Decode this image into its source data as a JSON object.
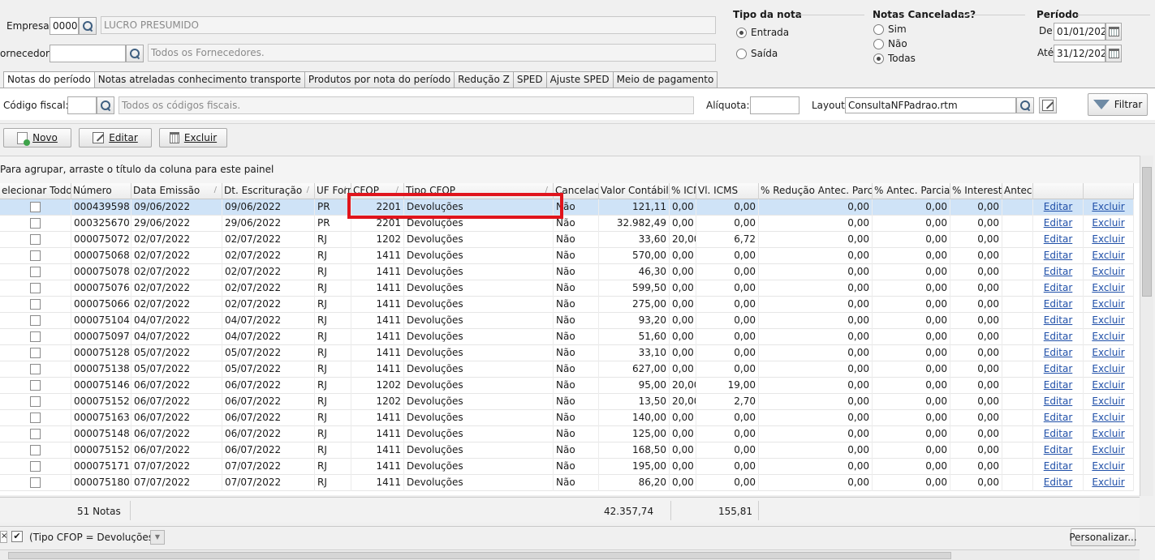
{
  "filters": {
    "empresa_label": "Empresa:",
    "empresa_code": "00001",
    "empresa_name": "LUCRO PRESUMIDO",
    "fornecedor_label": "ornecedor:",
    "fornecedor_code": "",
    "fornecedor_name": "Todos os Fornecedores."
  },
  "tipo_nota": {
    "title": "Tipo da nota",
    "options": [
      {
        "label": "Entrada",
        "selected": true
      },
      {
        "label": "Saída",
        "selected": false
      }
    ]
  },
  "notas_canceladas": {
    "title": "Notas Canceladas?",
    "options": [
      {
        "label": "Sim",
        "selected": false
      },
      {
        "label": "Não",
        "selected": false
      },
      {
        "label": "Todas",
        "selected": true
      }
    ]
  },
  "periodo": {
    "title": "Período",
    "de_label": "De",
    "de_value": "01/01/2022",
    "ate_label": "Até",
    "ate_value": "31/12/2022"
  },
  "tabs": [
    {
      "label": "Notas do período",
      "active": true
    },
    {
      "label": "Notas atreladas conhecimento transporte",
      "active": false
    },
    {
      "label": "Produtos por nota do período",
      "active": false
    },
    {
      "label": "Redução Z",
      "active": false
    },
    {
      "label": "SPED",
      "active": false
    },
    {
      "label": "Ajuste SPED",
      "active": false
    },
    {
      "label": "Meio de pagamento",
      "active": false
    }
  ],
  "panel": {
    "codigo_fiscal_label": "Código fiscal:",
    "codigo_fiscal_value": "",
    "codigo_fiscal_desc": "Todos os códigos fiscais.",
    "aliquota_label": "Alíquota:",
    "aliquota_value": "",
    "layout_label": "Layout:",
    "layout_value": "ConsultaNFPadrao.rtm",
    "filtrar_label": "Filtrar"
  },
  "toolbar": {
    "novo_label": "Novo",
    "editar_label": "Editar",
    "excluir_label": "Excluir"
  },
  "group_hint": "Para agrupar, arraste o título da coluna para este painel",
  "grid": {
    "headers": [
      "elecionar Todos",
      "Número",
      "Data Emissão",
      "Dt. Escrituração",
      "UF Forn",
      "CFOP",
      "Tipo CFOP",
      "Cancelada",
      "Valor Contábil",
      "% ICMS",
      "Vl. ICMS",
      "% Redução Antec. Parcial",
      "% Antec. Parcial",
      "% Interest.",
      "Antec.",
      "",
      ""
    ],
    "link_edit": "Editar",
    "link_delete": "Excluir",
    "rows": [
      {
        "numero": "000439598",
        "emissao": "09/06/2022",
        "escrit": "09/06/2022",
        "uf": "PR",
        "cfop": "2201",
        "tipo": "Devoluções",
        "cancelada": "Não",
        "valor": "121,11",
        "picms": "0,00",
        "vicms": "0,00",
        "red": "0,00",
        "antec": "0,00",
        "inter": "0,00"
      },
      {
        "numero": "000325670",
        "emissao": "29/06/2022",
        "escrit": "29/06/2022",
        "uf": "PR",
        "cfop": "2201",
        "tipo": "Devoluções",
        "cancelada": "Não",
        "valor": "32.982,49",
        "picms": "0,00",
        "vicms": "0,00",
        "red": "0,00",
        "antec": "0,00",
        "inter": "0,00"
      },
      {
        "numero": "000075072",
        "emissao": "02/07/2022",
        "escrit": "02/07/2022",
        "uf": "RJ",
        "cfop": "1202",
        "tipo": "Devoluções",
        "cancelada": "Não",
        "valor": "33,60",
        "picms": "20,00",
        "vicms": "6,72",
        "red": "0,00",
        "antec": "0,00",
        "inter": "0,00"
      },
      {
        "numero": "000075068",
        "emissao": "02/07/2022",
        "escrit": "02/07/2022",
        "uf": "RJ",
        "cfop": "1411",
        "tipo": "Devoluções",
        "cancelada": "Não",
        "valor": "570,00",
        "picms": "0,00",
        "vicms": "0,00",
        "red": "0,00",
        "antec": "0,00",
        "inter": "0,00"
      },
      {
        "numero": "000075078",
        "emissao": "02/07/2022",
        "escrit": "02/07/2022",
        "uf": "RJ",
        "cfop": "1411",
        "tipo": "Devoluções",
        "cancelada": "Não",
        "valor": "46,30",
        "picms": "0,00",
        "vicms": "0,00",
        "red": "0,00",
        "antec": "0,00",
        "inter": "0,00"
      },
      {
        "numero": "000075076",
        "emissao": "02/07/2022",
        "escrit": "02/07/2022",
        "uf": "RJ",
        "cfop": "1411",
        "tipo": "Devoluções",
        "cancelada": "Não",
        "valor": "599,50",
        "picms": "0,00",
        "vicms": "0,00",
        "red": "0,00",
        "antec": "0,00",
        "inter": "0,00"
      },
      {
        "numero": "000075066",
        "emissao": "02/07/2022",
        "escrit": "02/07/2022",
        "uf": "RJ",
        "cfop": "1411",
        "tipo": "Devoluções",
        "cancelada": "Não",
        "valor": "275,00",
        "picms": "0,00",
        "vicms": "0,00",
        "red": "0,00",
        "antec": "0,00",
        "inter": "0,00"
      },
      {
        "numero": "000075104",
        "emissao": "04/07/2022",
        "escrit": "04/07/2022",
        "uf": "RJ",
        "cfop": "1411",
        "tipo": "Devoluções",
        "cancelada": "Não",
        "valor": "93,20",
        "picms": "0,00",
        "vicms": "0,00",
        "red": "0,00",
        "antec": "0,00",
        "inter": "0,00"
      },
      {
        "numero": "000075097",
        "emissao": "04/07/2022",
        "escrit": "04/07/2022",
        "uf": "RJ",
        "cfop": "1411",
        "tipo": "Devoluções",
        "cancelada": "Não",
        "valor": "51,60",
        "picms": "0,00",
        "vicms": "0,00",
        "red": "0,00",
        "antec": "0,00",
        "inter": "0,00"
      },
      {
        "numero": "000075128",
        "emissao": "05/07/2022",
        "escrit": "05/07/2022",
        "uf": "RJ",
        "cfop": "1411",
        "tipo": "Devoluções",
        "cancelada": "Não",
        "valor": "33,10",
        "picms": "0,00",
        "vicms": "0,00",
        "red": "0,00",
        "antec": "0,00",
        "inter": "0,00"
      },
      {
        "numero": "000075138",
        "emissao": "05/07/2022",
        "escrit": "05/07/2022",
        "uf": "RJ",
        "cfop": "1411",
        "tipo": "Devoluções",
        "cancelada": "Não",
        "valor": "627,00",
        "picms": "0,00",
        "vicms": "0,00",
        "red": "0,00",
        "antec": "0,00",
        "inter": "0,00"
      },
      {
        "numero": "000075146",
        "emissao": "06/07/2022",
        "escrit": "06/07/2022",
        "uf": "RJ",
        "cfop": "1202",
        "tipo": "Devoluções",
        "cancelada": "Não",
        "valor": "95,00",
        "picms": "20,00",
        "vicms": "19,00",
        "red": "0,00",
        "antec": "0,00",
        "inter": "0,00"
      },
      {
        "numero": "000075152",
        "emissao": "06/07/2022",
        "escrit": "06/07/2022",
        "uf": "RJ",
        "cfop": "1202",
        "tipo": "Devoluções",
        "cancelada": "Não",
        "valor": "13,50",
        "picms": "20,00",
        "vicms": "2,70",
        "red": "0,00",
        "antec": "0,00",
        "inter": "0,00"
      },
      {
        "numero": "000075163",
        "emissao": "06/07/2022",
        "escrit": "06/07/2022",
        "uf": "RJ",
        "cfop": "1411",
        "tipo": "Devoluções",
        "cancelada": "Não",
        "valor": "140,00",
        "picms": "0,00",
        "vicms": "0,00",
        "red": "0,00",
        "antec": "0,00",
        "inter": "0,00"
      },
      {
        "numero": "000075148",
        "emissao": "06/07/2022",
        "escrit": "06/07/2022",
        "uf": "RJ",
        "cfop": "1411",
        "tipo": "Devoluções",
        "cancelada": "Não",
        "valor": "125,00",
        "picms": "0,00",
        "vicms": "0,00",
        "red": "0,00",
        "antec": "0,00",
        "inter": "0,00"
      },
      {
        "numero": "000075152",
        "emissao": "06/07/2022",
        "escrit": "06/07/2022",
        "uf": "RJ",
        "cfop": "1411",
        "tipo": "Devoluções",
        "cancelada": "Não",
        "valor": "168,50",
        "picms": "0,00",
        "vicms": "0,00",
        "red": "0,00",
        "antec": "0,00",
        "inter": "0,00"
      },
      {
        "numero": "000075171",
        "emissao": "07/07/2022",
        "escrit": "07/07/2022",
        "uf": "RJ",
        "cfop": "1411",
        "tipo": "Devoluções",
        "cancelada": "Não",
        "valor": "195,00",
        "picms": "0,00",
        "vicms": "0,00",
        "red": "0,00",
        "antec": "0,00",
        "inter": "0,00"
      },
      {
        "numero": "000075180",
        "emissao": "07/07/2022",
        "escrit": "07/07/2022",
        "uf": "RJ",
        "cfop": "1411",
        "tipo": "Devoluções",
        "cancelada": "Não",
        "valor": "86,20",
        "picms": "0,00",
        "vicms": "0,00",
        "red": "0,00",
        "antec": "0,00",
        "inter": "0,00"
      }
    ]
  },
  "footer": {
    "count": "51 Notas",
    "total_valor": "42.357,74",
    "total_icms": "155,81"
  },
  "filter_bar": {
    "expression": "(Tipo CFOP = Devoluções)",
    "personalizar_label": "Personalizar..."
  },
  "colors": {
    "selected_row": "#cfe3f7",
    "highlight": "#e0141c",
    "link": "#1f4fa8"
  }
}
